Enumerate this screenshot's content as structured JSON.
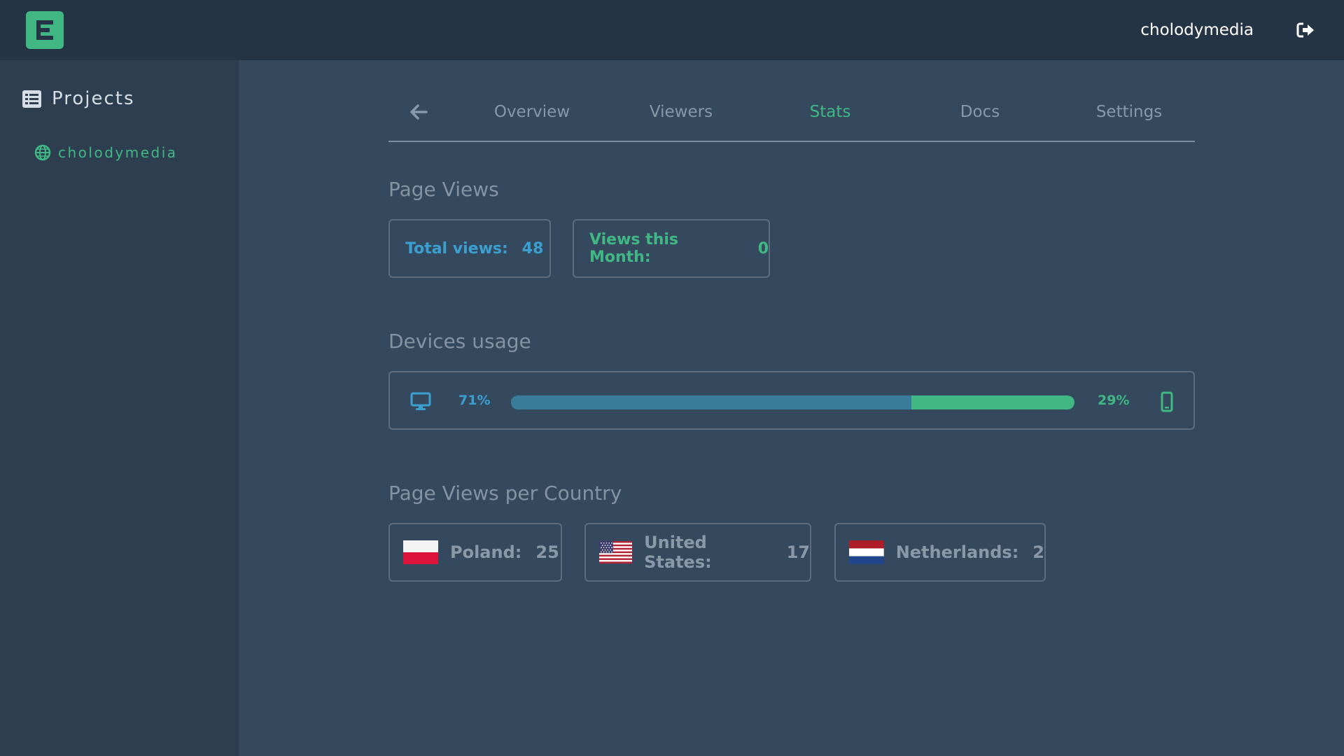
{
  "header": {
    "username": "cholodymedia",
    "logo_icon": "logo-e-icon",
    "logout_icon": "logout-icon",
    "brand_color": "#41b883"
  },
  "sidebar": {
    "title": "Projects",
    "title_icon": "list-icon",
    "items": [
      {
        "label": "cholodymedia",
        "icon": "globe-icon"
      }
    ]
  },
  "tabs": {
    "back_icon": "arrow-left-icon",
    "items": [
      {
        "label": "Overview",
        "active": false
      },
      {
        "label": "Viewers",
        "active": false
      },
      {
        "label": "Stats",
        "active": true
      },
      {
        "label": "Docs",
        "active": false
      },
      {
        "label": "Settings",
        "active": false
      }
    ]
  },
  "page_views": {
    "title": "Page Views",
    "total_label": "Total views:",
    "total_value": "48",
    "month_label": "Views this Month:",
    "month_value": "0"
  },
  "devices": {
    "title": "Devices usage",
    "desktop_icon": "desktop-icon",
    "mobile_icon": "mobile-icon",
    "desktop_pct": "71%",
    "mobile_pct": "29%",
    "desktop_fraction": 0.71,
    "desktop_color": "#3a7a9a",
    "mobile_color": "#41b883"
  },
  "countries": {
    "title": "Page Views per Country",
    "items": [
      {
        "name": "Poland:",
        "value": "25",
        "flag": "poland-flag-icon"
      },
      {
        "name": "United States:",
        "value": "17",
        "flag": "us-flag-icon"
      },
      {
        "name": "Netherlands:",
        "value": "2",
        "flag": "netherlands-flag-icon"
      }
    ]
  }
}
